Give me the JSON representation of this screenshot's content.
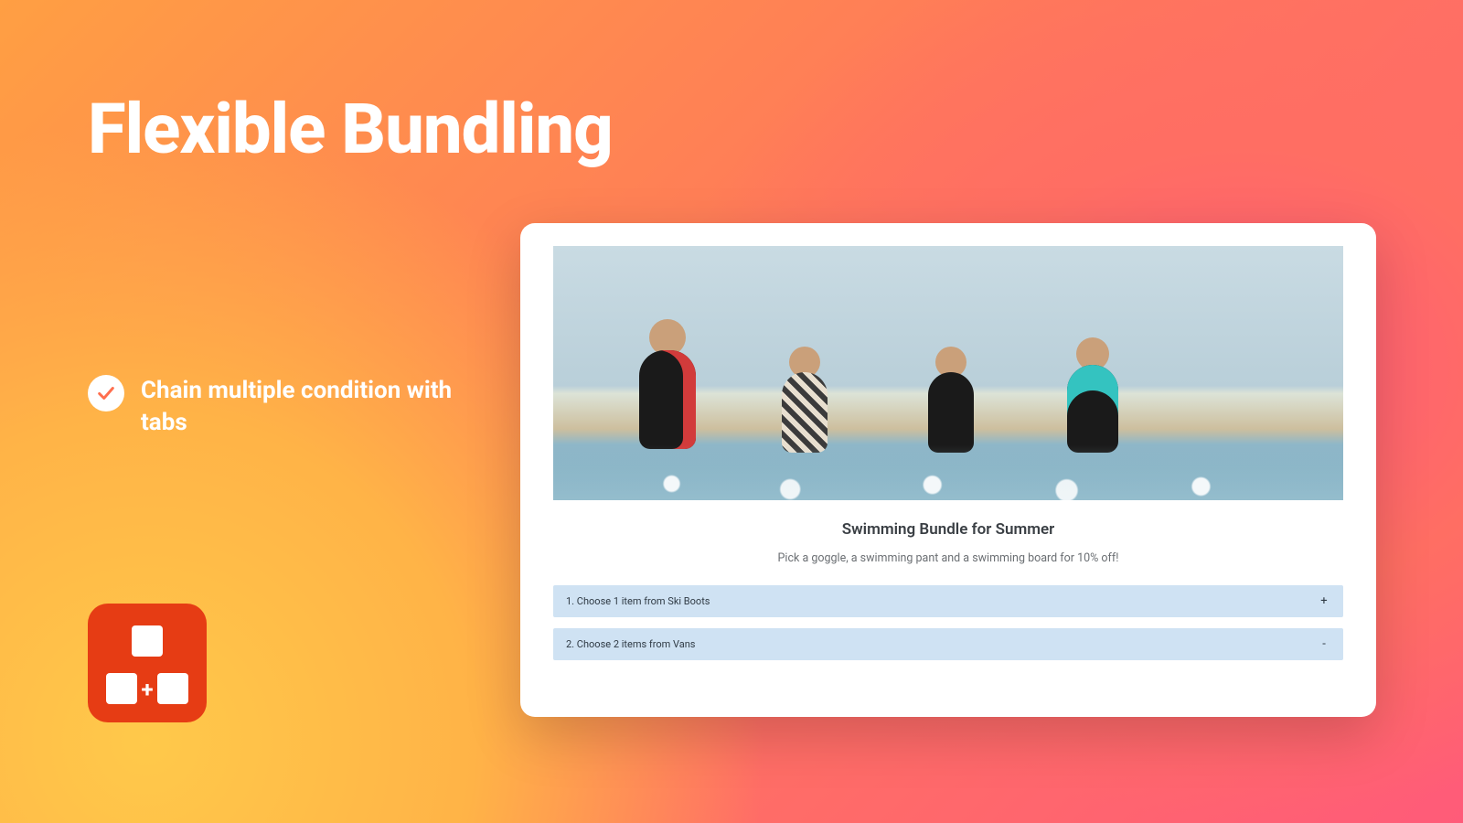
{
  "headline": "Flexible Bundling",
  "feature": {
    "text": "Chain multiple condition with tabs"
  },
  "appIcon": {
    "name": "bundle-app-icon",
    "plus": "+"
  },
  "card": {
    "bundleTitle": "Swimming Bundle for Summer",
    "bundleSubtitle": "Pick a goggle, a swimming pant and a swimming board for 10% off!",
    "accordion": [
      {
        "label": "1. Choose 1 item from Ski Boots",
        "toggle": "+"
      },
      {
        "label": "2. Choose 2 items from Vans",
        "toggle": "-"
      }
    ]
  }
}
